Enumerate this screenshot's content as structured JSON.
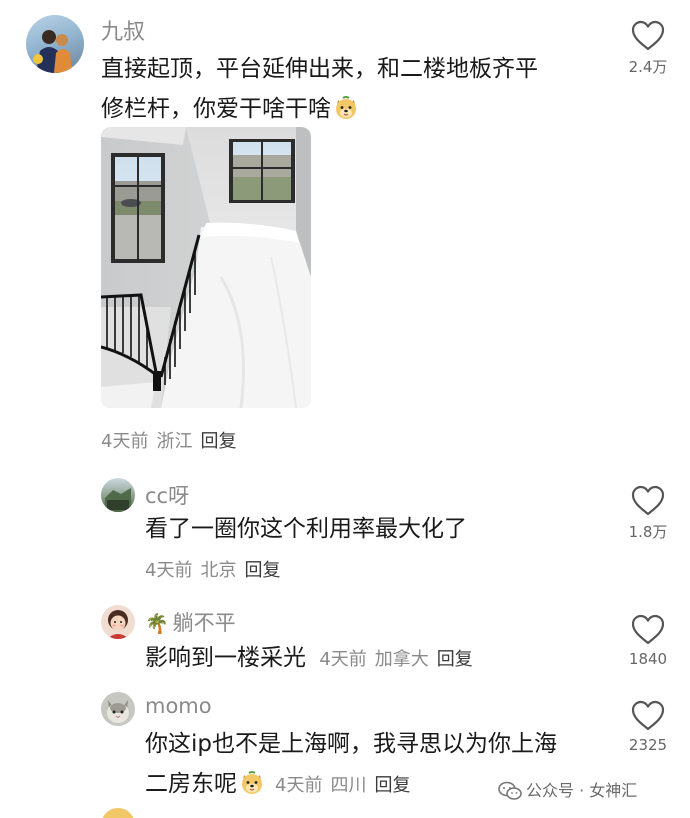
{
  "comments": [
    {
      "author": "九叔",
      "text_line1": "直接起顶，平台延伸出来，和二楼地板齐平",
      "text_line2": "修栏杆，你爱干啥干啥",
      "time": "4天前",
      "location": "浙江",
      "reply_label": "回复",
      "likes": "2.4万"
    }
  ],
  "replies": [
    {
      "author": "cc呀",
      "text": "看了一圈你这个利用率最大化了",
      "time": "4天前",
      "location": "北京",
      "reply_label": "回复",
      "likes": "1.8万"
    },
    {
      "author_emoji": "🌴",
      "author": "躺不平",
      "text": "影响到一楼采光",
      "time": "4天前",
      "location": "加拿大",
      "reply_label": "回复",
      "likes": "1840"
    },
    {
      "author": "momo",
      "text_line1": "你这ip也不是上海啊，我寻思以为你上海",
      "text_line2": "二房东呢",
      "time": "4天前",
      "location": "四川",
      "reply_label": "回复",
      "likes": "2325"
    }
  ],
  "watermark": {
    "text": "公众号 · 女神汇",
    "icon": "wechat-icon"
  },
  "colors": {
    "username": "#8a8a8a",
    "meta": "#8a8a8a",
    "text": "#1a1a1a"
  }
}
